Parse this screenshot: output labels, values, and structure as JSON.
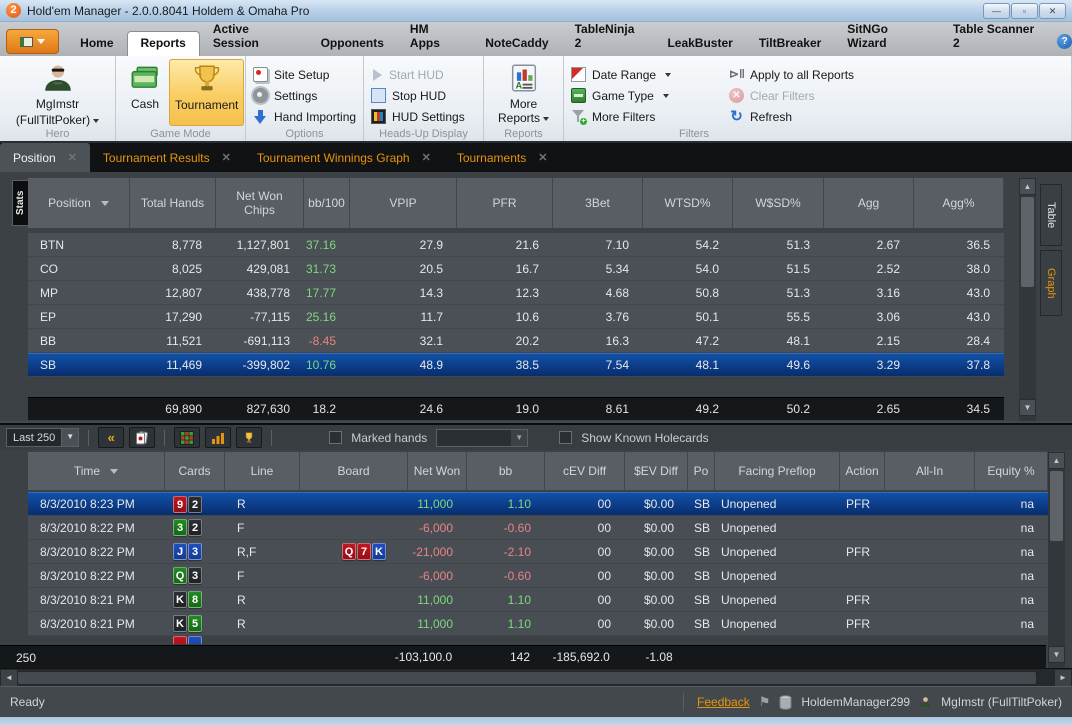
{
  "window": {
    "title": "Hold'em Manager - 2.0.0.8041 Holdem & Omaha Pro",
    "logo": "2",
    "controls": {
      "minimize": "—",
      "maximize": "▫",
      "close": "✕"
    }
  },
  "menu": {
    "tabs": [
      {
        "label": "Home",
        "active": false
      },
      {
        "label": "Reports",
        "active": true
      },
      {
        "label": "Active Session",
        "active": false
      },
      {
        "label": "Opponents",
        "active": false
      },
      {
        "label": "HM Apps",
        "active": false
      },
      {
        "label": "NoteCaddy",
        "active": false
      },
      {
        "label": "TableNinja 2",
        "active": false
      },
      {
        "label": "LeakBuster",
        "active": false
      },
      {
        "label": "TiltBreaker",
        "active": false
      },
      {
        "label": "SitNGo Wizard",
        "active": false
      },
      {
        "label": "Table Scanner 2",
        "active": false
      }
    ],
    "help": "?"
  },
  "ribbon": {
    "hero": {
      "name": "MgImstr",
      "site": "(FullTiltPoker)",
      "caption": "Hero"
    },
    "game_mode": {
      "cash_label": "Cash",
      "tournament_label": "Tournament",
      "caption": "Game Mode"
    },
    "options": {
      "site_setup": "Site Setup",
      "settings": "Settings",
      "hand_importing": "Hand Importing",
      "caption": "Options"
    },
    "hud": {
      "start": "Start HUD",
      "stop": "Stop HUD",
      "settings": "HUD Settings",
      "caption": "Heads-Up Display"
    },
    "reports_group": {
      "more_reports": "More Reports",
      "caption": "Reports"
    },
    "filters": {
      "date_range": "Date Range",
      "game_type": "Game Type",
      "more_filters": "More Filters",
      "apply_all": "Apply to all Reports",
      "clear": "Clear Filters",
      "refresh": "Refresh",
      "caption": "Filters"
    }
  },
  "doc_tabs": [
    {
      "label": "Position",
      "active": true
    },
    {
      "label": "Tournament Results",
      "active": false
    },
    {
      "label": "Tournament Winnings Graph",
      "active": false
    },
    {
      "label": "Tournaments",
      "active": false
    }
  ],
  "side_tabs": {
    "left": "Stats",
    "right": [
      "Table",
      "Graph"
    ]
  },
  "stats_table": {
    "columns": [
      "Position",
      "Total Hands",
      "Net Won Chips",
      "bb/100",
      "VPIP",
      "PFR",
      "3Bet",
      "WTSD%",
      "W$SD%",
      "Agg",
      "Agg%"
    ],
    "rows": [
      {
        "position": "BTN",
        "values": [
          "8,778",
          "1,127,801",
          "37.16",
          "27.9",
          "21.6",
          "7.10",
          "54.2",
          "51.3",
          "2.67",
          "36.5"
        ],
        "selected": false
      },
      {
        "position": "CO",
        "values": [
          "8,025",
          "429,081",
          "31.73",
          "20.5",
          "16.7",
          "5.34",
          "54.0",
          "51.5",
          "2.52",
          "38.0"
        ],
        "selected": false
      },
      {
        "position": "MP",
        "values": [
          "12,807",
          "438,778",
          "17.77",
          "14.3",
          "12.3",
          "4.68",
          "50.8",
          "51.3",
          "3.16",
          "43.0"
        ],
        "selected": false
      },
      {
        "position": "EP",
        "values": [
          "17,290",
          "-77,115",
          "25.16",
          "11.7",
          "10.6",
          "3.76",
          "50.1",
          "55.5",
          "3.06",
          "43.0"
        ],
        "selected": false
      },
      {
        "position": "BB",
        "values": [
          "11,521",
          "-691,113",
          "-8.45",
          "32.1",
          "20.2",
          "16.3",
          "47.2",
          "48.1",
          "2.15",
          "28.4"
        ],
        "selected": false
      },
      {
        "position": "SB",
        "values": [
          "11,469",
          "-399,802",
          "10.76",
          "48.9",
          "38.5",
          "7.54",
          "48.1",
          "49.6",
          "3.29",
          "37.8"
        ],
        "selected": true
      }
    ],
    "totals": [
      "",
      "69,890",
      "827,630",
      "18.2",
      "24.6",
      "19.0",
      "8.61",
      "49.2",
      "50.2",
      "2.65",
      "34.5"
    ]
  },
  "hands_toolbar": {
    "range_selector": "Last 250",
    "marked_hands_label": "Marked hands",
    "show_known_label": "Show Known Holecards"
  },
  "hands_table": {
    "columns": [
      "Time",
      "Cards",
      "Line",
      "Board",
      "Net Won",
      "bb",
      "cEV Diff",
      "$EV Diff",
      "Po",
      "Facing Preflop",
      "Action",
      "All-In",
      "Equity %"
    ],
    "rows": [
      {
        "time": "8/3/2010 8:23 PM",
        "cards": [
          {
            "rank": "9",
            "suit": "h"
          },
          {
            "rank": "2",
            "suit": "s"
          }
        ],
        "line": "R",
        "board": [],
        "net_won": "11,000",
        "bb": "1.10",
        "cev_diff": "00",
        "sev_diff": "$0.00",
        "po": "SB",
        "facing_preflop": "Unopened",
        "action": "PFR",
        "all_in": "",
        "equity": "na",
        "selected": true
      },
      {
        "time": "8/3/2010 8:22 PM",
        "cards": [
          {
            "rank": "3",
            "suit": "c"
          },
          {
            "rank": "2",
            "suit": "s"
          }
        ],
        "line": "F",
        "board": [],
        "net_won": "-6,000",
        "bb": "-0.60",
        "cev_diff": "00",
        "sev_diff": "$0.00",
        "po": "SB",
        "facing_preflop": "Unopened",
        "action": "",
        "all_in": "",
        "equity": "na",
        "selected": false
      },
      {
        "time": "8/3/2010 8:22 PM",
        "cards": [
          {
            "rank": "J",
            "suit": "d"
          },
          {
            "rank": "3",
            "suit": "d"
          }
        ],
        "line": "R,F",
        "board": [
          {
            "rank": "Q",
            "suit": "h"
          },
          {
            "rank": "7",
            "suit": "h"
          },
          {
            "rank": "K",
            "suit": "d"
          }
        ],
        "net_won": "-21,000",
        "bb": "-2.10",
        "cev_diff": "00",
        "sev_diff": "$0.00",
        "po": "SB",
        "facing_preflop": "Unopened",
        "action": "PFR",
        "all_in": "",
        "equity": "na",
        "selected": false
      },
      {
        "time": "8/3/2010 8:22 PM",
        "cards": [
          {
            "rank": "Q",
            "suit": "c"
          },
          {
            "rank": "3",
            "suit": "s"
          }
        ],
        "line": "F",
        "board": [],
        "net_won": "-6,000",
        "bb": "-0.60",
        "cev_diff": "00",
        "sev_diff": "$0.00",
        "po": "SB",
        "facing_preflop": "Unopened",
        "action": "",
        "all_in": "",
        "equity": "na",
        "selected": false
      },
      {
        "time": "8/3/2010 8:21 PM",
        "cards": [
          {
            "rank": "K",
            "suit": "s"
          },
          {
            "rank": "8",
            "suit": "c"
          }
        ],
        "line": "R",
        "board": [],
        "net_won": "11,000",
        "bb": "1.10",
        "cev_diff": "00",
        "sev_diff": "$0.00",
        "po": "SB",
        "facing_preflop": "Unopened",
        "action": "PFR",
        "all_in": "",
        "equity": "na",
        "selected": false
      },
      {
        "time": "8/3/2010 8:21 PM",
        "cards": [
          {
            "rank": "K",
            "suit": "s"
          },
          {
            "rank": "5",
            "suit": "c"
          }
        ],
        "line": "R",
        "board": [],
        "net_won": "11,000",
        "bb": "1.10",
        "cev_diff": "00",
        "sev_diff": "$0.00",
        "po": "SB",
        "facing_preflop": "Unopened",
        "action": "PFR",
        "all_in": "",
        "equity": "na",
        "selected": false
      }
    ],
    "partial_row": {
      "cards": [
        {
          "rank": "",
          "suit": "h"
        },
        {
          "rank": "",
          "suit": "d"
        }
      ]
    },
    "totals": {
      "count": "250",
      "net_won": "-103,100.0",
      "bb": "142",
      "cev_diff": "-185,692.0",
      "sev_diff": "-1.08"
    }
  },
  "statusbar": {
    "status": "Ready",
    "feedback": "Feedback",
    "database": "HoldemManager299",
    "user": "MgImstr (FullTiltPoker)"
  },
  "colors": {
    "accent_orange": "#e8940a",
    "selected_row": "#0b3c8c",
    "positive": "#7fd87f",
    "negative": "#e88484",
    "suit_hearts": "#c41420",
    "suit_spades": "#2a2d31",
    "suit_clubs": "#1f8a1f",
    "suit_diamonds": "#1d4fc0"
  }
}
